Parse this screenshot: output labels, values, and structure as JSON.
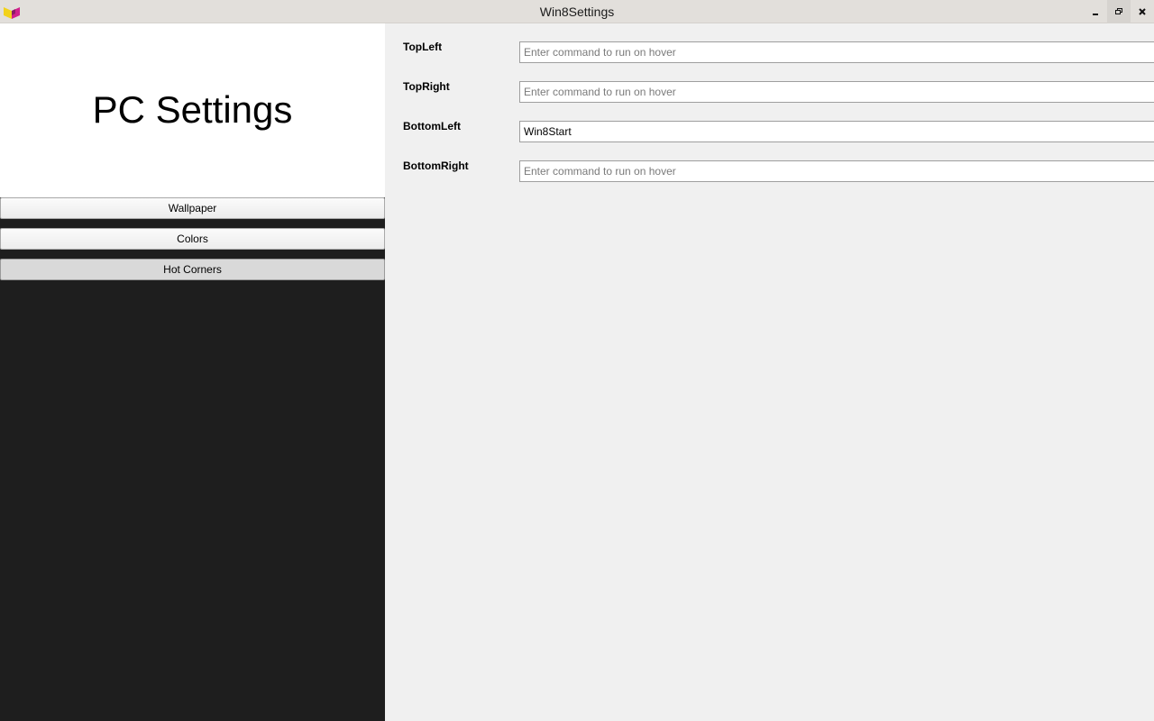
{
  "window": {
    "title": "Win8Settings",
    "minimize_icon": "minimize-icon",
    "maximize_icon": "restore-icon",
    "close_icon": "close-icon"
  },
  "sidebar": {
    "title": "PC Settings",
    "items": [
      {
        "label": "Wallpaper",
        "active": false
      },
      {
        "label": "Colors",
        "active": false
      },
      {
        "label": "Hot Corners",
        "active": true
      }
    ],
    "background_color": "#1e1e1e",
    "header_color": "#ffffff"
  },
  "hot_corners": {
    "rows": [
      {
        "label": "TopLeft",
        "value": "",
        "placeholder": "Enter command to run on hover"
      },
      {
        "label": "TopRight",
        "value": "",
        "placeholder": "Enter command to run on hover"
      },
      {
        "label": "BottomLeft",
        "value": "Win8Start",
        "placeholder": "Enter command to run on hover"
      },
      {
        "label": "BottomRight",
        "value": "",
        "placeholder": "Enter command to run on hover"
      }
    ]
  },
  "colors": {
    "icon_yellow": "#f2d21a",
    "icon_magenta": "#d0208c"
  }
}
